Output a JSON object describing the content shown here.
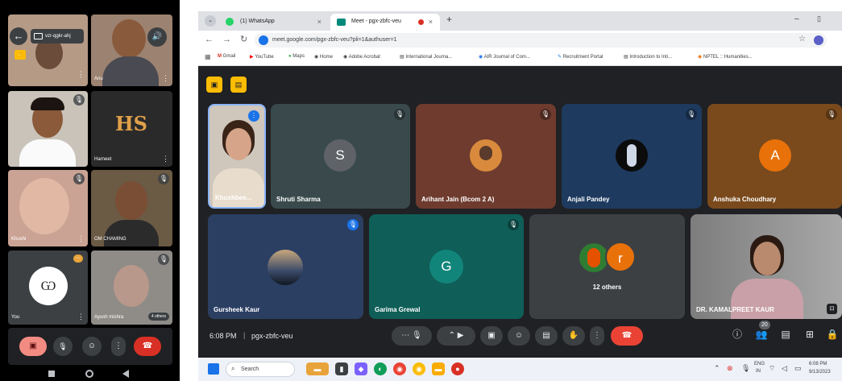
{
  "phone": {
    "meeting_code": "vzr-qgkr-ahj",
    "tiles": [
      {
        "name": ""
      },
      {
        "name": "Anu"
      },
      {
        "name": ""
      },
      {
        "name": "Harneet",
        "initials": "HS"
      },
      {
        "name": "Khushi"
      },
      {
        "name": "OM CHAMING"
      },
      {
        "name": "You"
      },
      {
        "name": "Ayush mishra",
        "others": "4 others"
      }
    ],
    "controls": [
      "video-off",
      "mic",
      "emoji",
      "more",
      "hang-up"
    ],
    "nav": [
      "back",
      "home",
      "recents"
    ]
  },
  "browser": {
    "tabs": [
      {
        "title": "(1) WhatsApp",
        "active": false
      },
      {
        "title": "Meet - pgx-zbfc-veu",
        "active": true
      }
    ],
    "new_tab": "+",
    "window_min": "–",
    "window_restore": "▯",
    "url": "meet.google.com/pgx-zbfc-veu?pli=1&authuser=1",
    "bookmarks": [
      "Gmail",
      "YouTube",
      "Maps",
      "Home",
      "Adobe Acrobat",
      "International Journa...",
      "AIR Journal of Com...",
      "Recruitment Portal",
      "Introduction to Inti...",
      "NPTEL :: Humanities..."
    ]
  },
  "meet": {
    "participants": [
      {
        "name": "Khushbee...",
        "type": "video"
      },
      {
        "name": "Shruti Sharma",
        "initial": "S",
        "avatar_color": "#5f6368",
        "bg": "#3a4a4c"
      },
      {
        "name": "Arihant Jain (Bcom 2 A)",
        "type": "photo",
        "bg": "#6e3b2e"
      },
      {
        "name": "Anjali Pandey",
        "type": "photo",
        "bg": "#1e3a5f"
      },
      {
        "name": "Anshuka Choudhary",
        "initial": "A",
        "avatar_color": "#e8710a",
        "bg": "#7a4a1c"
      },
      {
        "name": "Gursheek Kaur",
        "type": "photo",
        "bg": "#2b3f63"
      },
      {
        "name": "Garima Grewal",
        "initial": "G",
        "avatar_color": "#12857b",
        "bg": "#0f5e58"
      },
      {
        "name": "12 others",
        "initial": "r",
        "avatar_color": "#e8710a",
        "bg": "#3c4043"
      },
      {
        "name": "DR. KAMALPREET KAUR",
        "type": "video",
        "bg": "#8a8a8a"
      }
    ],
    "time": "6:08 PM",
    "meeting_code": "pgx-zbfc-veu",
    "people_count": "20"
  },
  "taskbar": {
    "search": "Search",
    "lang": "ENG",
    "region": "IN",
    "clock_time": "6:08 PM",
    "clock_date": "9/13/2023"
  }
}
